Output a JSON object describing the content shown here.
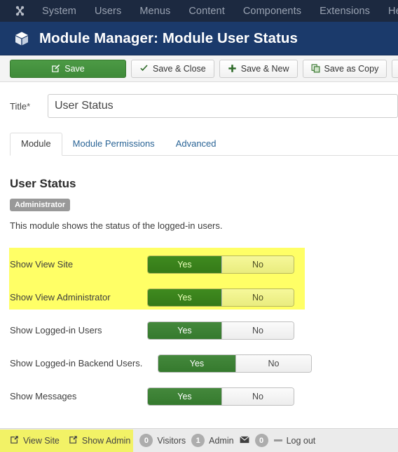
{
  "topnav": {
    "logo_icon": "joomla-logo-icon",
    "items": [
      {
        "label": "System"
      },
      {
        "label": "Users"
      },
      {
        "label": "Menus"
      },
      {
        "label": "Content"
      },
      {
        "label": "Components"
      },
      {
        "label": "Extensions"
      },
      {
        "label": "Help"
      }
    ],
    "background": "#1c2940",
    "text_color": "#9aa3b2"
  },
  "header": {
    "icon": "cube-icon",
    "title": "Module Manager: Module User Status",
    "background": "#1b3a6b"
  },
  "toolbar": {
    "save_label": "Save",
    "save_icon": "edit-square-icon",
    "save_close_label": "Save & Close",
    "save_close_icon": "check-icon",
    "save_new_label": "Save & New",
    "save_new_icon": "plus-icon",
    "save_copy_label": "Save as Copy",
    "save_copy_icon": "copy-icon",
    "close_icon": "cancel-circle-icon",
    "primary_color": "#3f8a39"
  },
  "form": {
    "title_label": "Title",
    "title_required_marker": "*",
    "title_value": "User Status",
    "title_placeholder": "Title"
  },
  "tabs": [
    {
      "label": "Module",
      "active": true
    },
    {
      "label": "Module Permissions",
      "active": false
    },
    {
      "label": "Advanced",
      "active": false
    }
  ],
  "module": {
    "name": "User Status",
    "client_badge": "Administrator",
    "description": "This module shows the status of the logged-in users."
  },
  "settings": {
    "yes_label": "Yes",
    "no_label": "No",
    "highlight_color": "#ffff66",
    "rows": [
      {
        "label": "Show View Site",
        "value": "Yes",
        "highlighted": true,
        "label_width": 196,
        "toggle_width": 210
      },
      {
        "label": "Show View Administrator",
        "value": "Yes",
        "highlighted": true,
        "label_width": 196,
        "toggle_width": 210
      },
      {
        "label": "Show Logged-in Users",
        "value": "Yes",
        "highlighted": false,
        "label_width": 196,
        "toggle_width": 210
      },
      {
        "label": "Show Logged-in Backend Users.",
        "value": "Yes",
        "highlighted": false,
        "label_width": 211,
        "toggle_width": 220
      },
      {
        "label": "Show Messages",
        "value": "Yes",
        "highlighted": false,
        "label_width": 196,
        "toggle_width": 210
      }
    ]
  },
  "footer": {
    "view_site_label": "View Site",
    "view_site_icon": "external-link-icon",
    "show_admin_label": "Show Admin",
    "show_admin_icon": "external-link-icon",
    "visitors_count": "0",
    "visitors_label": "Visitors",
    "admin_count": "1",
    "admin_label": "Admin",
    "messages_icon": "envelope-icon",
    "messages_count": "0",
    "logout_label": "Log out",
    "highlight_color": "#f2f266"
  }
}
